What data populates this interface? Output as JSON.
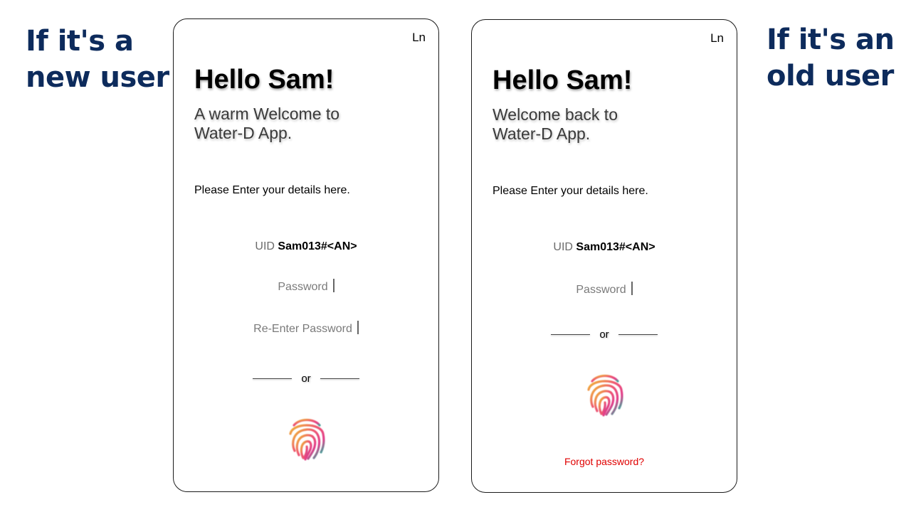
{
  "captions": {
    "new_user": [
      "If it's a",
      "new user"
    ],
    "old_user": [
      "If it's an",
      "old user"
    ]
  },
  "new_user_screen": {
    "language_button": "Ln",
    "greeting": "Hello Sam!",
    "welcome_lines": [
      "A warm Welcome to",
      "Water-D App."
    ],
    "instruction": "Please Enter your details here.",
    "uid_label": "UID",
    "uid_value": "Sam013#<AN>",
    "password_placeholder": "Password",
    "reenter_password_placeholder": "Re-Enter Password",
    "divider_text": "or",
    "biometric_icon": "fingerprint-icon"
  },
  "old_user_screen": {
    "language_button": "Ln",
    "greeting": "Hello Sam!",
    "welcome_lines": [
      "Welcome back to",
      "Water-D App."
    ],
    "instruction": "Please Enter your details here.",
    "uid_label": "UID",
    "uid_value": "Sam013#<AN>",
    "password_placeholder": "Password",
    "divider_text": "or",
    "biometric_icon": "fingerprint-icon",
    "forgot_password_link": "Forgot password?"
  },
  "colors": {
    "caption": "#0d2b5c",
    "forgot_link": "#e00000"
  }
}
